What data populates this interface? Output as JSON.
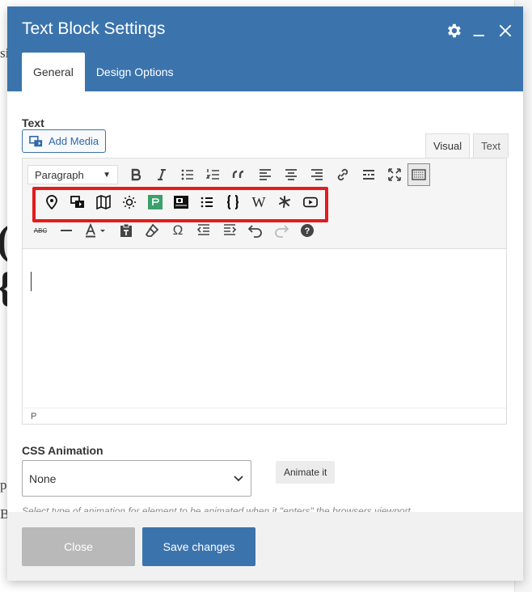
{
  "background": {
    "frag_si": "si",
    "frag_brace1": "(",
    "frag_brace2": "{",
    "frag_p": "p",
    "frag_b": "B"
  },
  "modal": {
    "title": "Text Block Settings",
    "header_icons": [
      "gear-icon",
      "minimize-icon",
      "close-icon"
    ],
    "tabs": [
      {
        "label": "General",
        "active": true
      },
      {
        "label": "Design Options",
        "active": false
      }
    ],
    "text_label": "Text",
    "add_media_label": "Add Media",
    "editor_tabs": [
      {
        "label": "Visual",
        "active": true
      },
      {
        "label": "Text",
        "active": false
      }
    ],
    "paragraph_select": "Paragraph",
    "toolbar_row1": [
      "bold-icon",
      "italic-icon",
      "bullet-list-icon",
      "numbered-list-icon",
      "blockquote-icon",
      "align-left-icon",
      "align-center-icon",
      "align-right-icon",
      "link-icon",
      "read-more-icon",
      "fullscreen-icon",
      "toolbar-toggle-icon"
    ],
    "toolbar_row2": [
      "map-pin-icon",
      "media-library-icon",
      "map-icon",
      "sun-icon",
      "green-square-icon",
      "camera-badge-icon",
      "list-icon",
      "curly-braces-icon",
      "wikipedia-icon",
      "yelp-icon",
      "youtube-icon"
    ],
    "toolbar_row3": [
      "strikethrough-icon",
      "horizontal-line-icon",
      "text-color-icon",
      "paste-text-icon",
      "eraser-icon",
      "omega-icon",
      "outdent-icon",
      "indent-icon",
      "undo-icon",
      "redo-icon",
      "help-icon"
    ],
    "status_path": "P",
    "css_animation_label": "CSS Animation",
    "css_animation_value": "None",
    "animate_button": "Animate it",
    "help_text": "Select type of animation for element to be animated when it \"enters\" the browsers viewport",
    "close_button": "Close",
    "save_button": "Save changes",
    "colors": {
      "header": "#3b74ad",
      "highlight": "#e31c1c",
      "close_bg": "#b9b9b9",
      "save_bg": "#3b74ad"
    }
  }
}
